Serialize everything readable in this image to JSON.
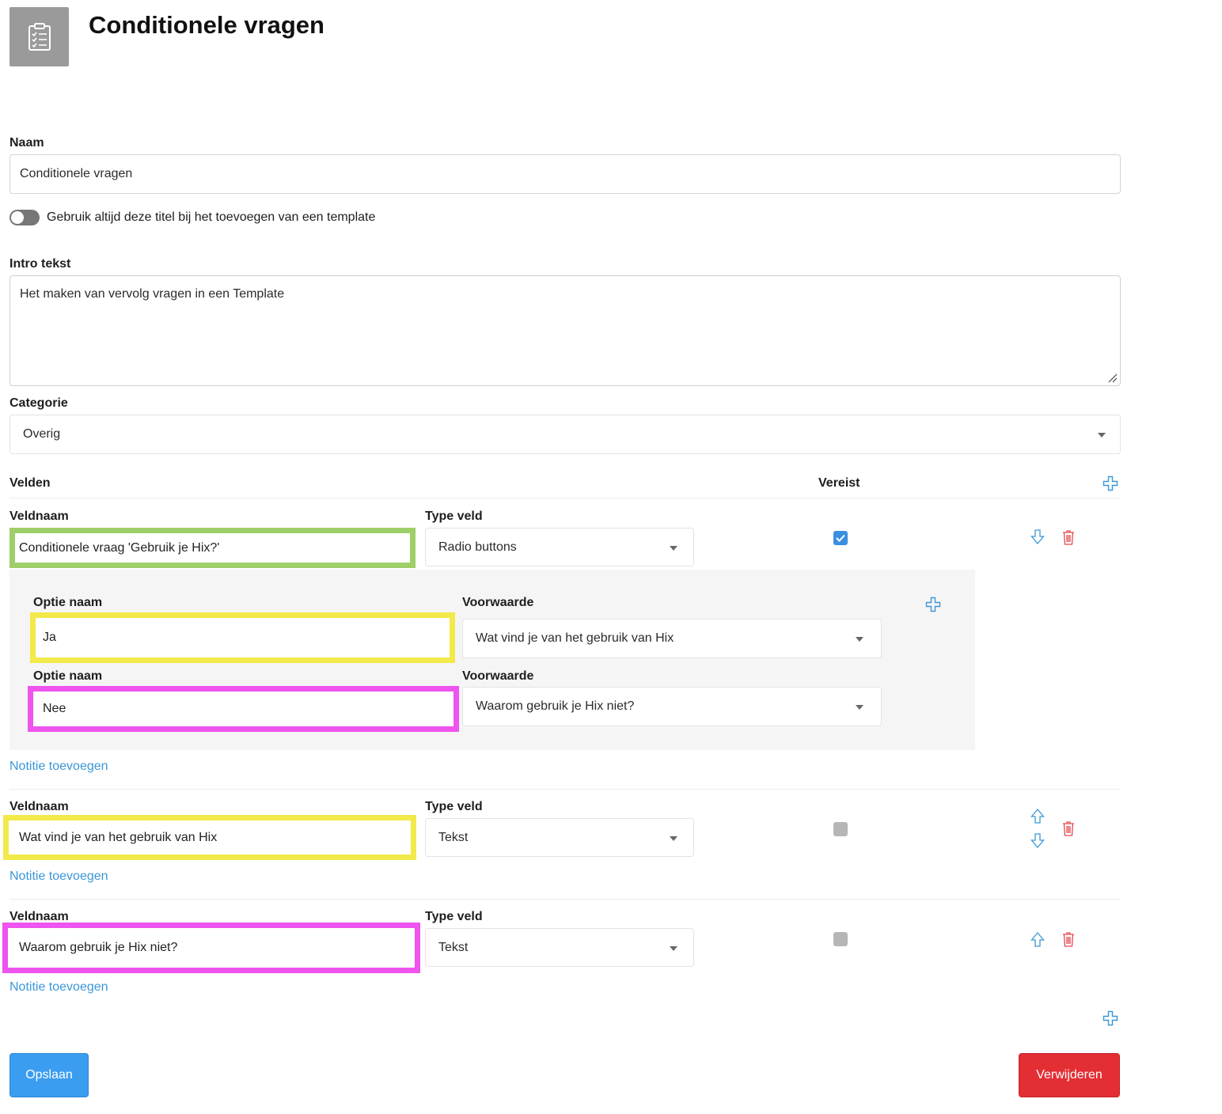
{
  "header": {
    "icon": "clipboard-checklist-icon",
    "title": "Conditionele vragen"
  },
  "form": {
    "name_label": "Naam",
    "name_value": "Conditionele vragen",
    "toggle_label": "Gebruik altijd deze titel bij het toevoegen van een template",
    "toggle_on": false,
    "intro_label": "Intro tekst",
    "intro_value": "Het maken van vervolg vragen in een Template",
    "category_label": "Categorie",
    "category_value": "Overig"
  },
  "fields_section": {
    "title": "Velden",
    "required_header": "Vereist",
    "add_icon": "plus-icon"
  },
  "fields": [
    {
      "name_label": "Veldnaam",
      "name_value": "Conditionele vraag 'Gebruik je Hix?'",
      "type_label": "Type veld",
      "type_value": "Radio buttons",
      "required": true,
      "highlight": "#9fcf6a",
      "note_link": "Notitie toevoegen",
      "options": [
        {
          "name_label": "Optie naam",
          "name_value": "Ja",
          "condition_label": "Voorwaarde",
          "condition_value": "Wat vind je van het gebruik van Hix",
          "highlight": "#f2e94a"
        },
        {
          "name_label": "Optie naam",
          "name_value": "Nee",
          "condition_label": "Voorwaarde",
          "condition_value": "Waarom gebruik je Hix niet?",
          "highlight": "#ee54ee"
        }
      ]
    },
    {
      "name_label": "Veldnaam",
      "name_value": "Wat vind je van het gebruik van Hix",
      "type_label": "Type veld",
      "type_value": "Tekst",
      "required": false,
      "highlight": "#f2e94a",
      "note_link": "Notitie toevoegen"
    },
    {
      "name_label": "Veldnaam",
      "name_value": "Waarom gebruik je Hix niet?",
      "type_label": "Type veld",
      "type_value": "Tekst",
      "required": false,
      "highlight": "#ee54ee",
      "note_link": "Notitie toevoegen"
    }
  ],
  "actions": {
    "save_label": "Opslaan",
    "delete_label": "Verwijderen"
  },
  "colors": {
    "link": "#3a97d8",
    "primary": "#3a9df0",
    "danger": "#e32e34",
    "checkbox": "#3a8fe0"
  }
}
